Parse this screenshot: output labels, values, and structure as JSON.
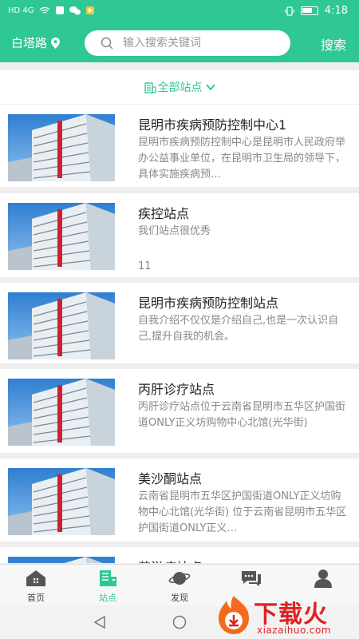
{
  "status_bar": {
    "network": "HD 4G",
    "time": "4:18"
  },
  "header": {
    "location": "白塔路",
    "search_placeholder": "输入搜索关键词",
    "search_button": "搜索"
  },
  "filter": {
    "label": "全部站点"
  },
  "stations": [
    {
      "title": "昆明市疾病预防控制中心1",
      "desc": "昆明市疾病预防控制中心是昆明市人民政府举办公益事业单位，在昆明市卫生局的领导下，具体实施疾病预…",
      "count": ""
    },
    {
      "title": "疾控站点",
      "desc": "我们站点很优秀",
      "count": "11"
    },
    {
      "title": "昆明市疾病预防控制站点",
      "desc": "自我介绍不仅仅是介绍自己,也是一次认识自己,提升自我的机会。",
      "count": ""
    },
    {
      "title": "丙肝诊疗站点",
      "desc": "丙肝诊疗站点位于云南省昆明市五华区护国街道ONLY正义坊购物中心北馆(光华街)",
      "count": ""
    },
    {
      "title": "美沙酮站点",
      "desc": "云南省昆明市五华区护国街道ONLY正义坊购物中心北馆(光华街) 位于云南省昆明市五华区护国街道ONLY正义…",
      "count": ""
    },
    {
      "title": "艾滋病站点",
      "desc": "",
      "count": ""
    }
  ],
  "tabs": [
    {
      "label": "首页",
      "icon": "home-icon",
      "active": false
    },
    {
      "label": "站点",
      "icon": "station-icon",
      "active": true
    },
    {
      "label": "发现",
      "icon": "planet-icon",
      "active": false
    },
    {
      "label": "",
      "icon": "chat-icon",
      "active": false
    },
    {
      "label": "",
      "icon": "user-icon",
      "active": false
    }
  ],
  "watermark": {
    "text": "下载火",
    "url": "xiazaihuo.com"
  },
  "colors": {
    "accent": "#2ec795",
    "watermark": "#e02020"
  }
}
